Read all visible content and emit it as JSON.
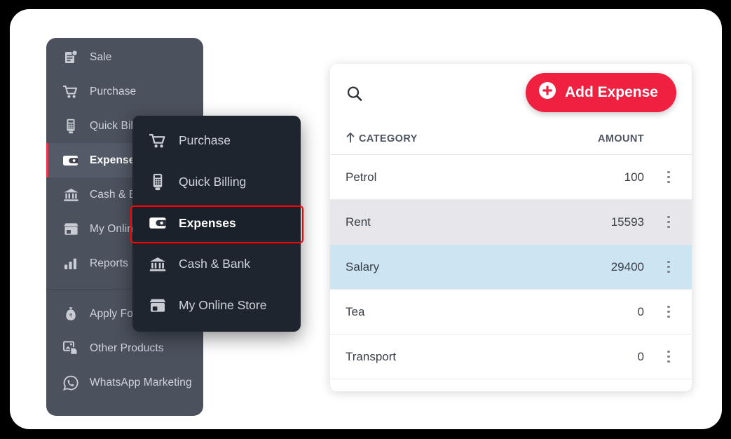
{
  "sidebar": {
    "items": [
      {
        "label": "Sale",
        "icon": "sale-document-icon",
        "active": false
      },
      {
        "label": "Purchase",
        "icon": "shopping-cart-icon",
        "active": false
      },
      {
        "label": "Quick Billing",
        "icon": "pos-terminal-icon",
        "active": false
      },
      {
        "label": "Expenses",
        "icon": "wallet-icon",
        "active": true
      },
      {
        "label": "Cash & Bank",
        "icon": "bank-building-icon",
        "active": false
      },
      {
        "label": "My Online Store",
        "icon": "storefront-icon",
        "active": false
      },
      {
        "label": "Reports",
        "icon": "bar-chart-icon",
        "active": false
      }
    ],
    "bottom_items": [
      {
        "label": "Apply For Loan",
        "icon": "money-bag-icon"
      },
      {
        "label": "Other Products",
        "icon": "stacked-documents-icon"
      },
      {
        "label": "WhatsApp Marketing",
        "icon": "whatsapp-icon"
      }
    ]
  },
  "submenu": {
    "items": [
      {
        "label": "Purchase",
        "icon": "shopping-cart-icon",
        "highlighted": false
      },
      {
        "label": "Quick Billing",
        "icon": "pos-terminal-icon",
        "highlighted": false
      },
      {
        "label": "Expenses",
        "icon": "wallet-icon",
        "highlighted": true
      },
      {
        "label": "Cash & Bank",
        "icon": "bank-building-icon",
        "highlighted": false
      },
      {
        "label": "My Online Store",
        "icon": "storefront-icon",
        "highlighted": false
      }
    ]
  },
  "panel": {
    "search": {
      "icon": "search-icon",
      "value": "",
      "placeholder": ""
    },
    "add_button": {
      "label": "Add Expense",
      "icon": "plus-circle-icon"
    },
    "table": {
      "columns": [
        {
          "key": "category",
          "label": "CATEGORY",
          "sort_icon": "sort-ascending-arrow-icon"
        },
        {
          "key": "amount",
          "label": "AMOUNT"
        }
      ],
      "rows": [
        {
          "category": "Petrol",
          "amount": "100",
          "state": "normal"
        },
        {
          "category": "Rent",
          "amount": "15593",
          "state": "alt"
        },
        {
          "category": "Salary",
          "amount": "29400",
          "state": "selected"
        },
        {
          "category": "Tea",
          "amount": "0",
          "state": "normal"
        },
        {
          "category": "Transport",
          "amount": "0",
          "state": "normal"
        }
      ],
      "row_menu_icon": "kebab-menu-icon"
    }
  },
  "colors": {
    "page_background": "#000000",
    "card_background": "#ffffff",
    "sidebar_background": "#4b515d",
    "submenu_background": "#1f252e",
    "accent_red": "#ef2040",
    "highlight_outline": "#ff0000",
    "row_selected": "#cde4f2",
    "row_alt": "#e7e6ea"
  }
}
